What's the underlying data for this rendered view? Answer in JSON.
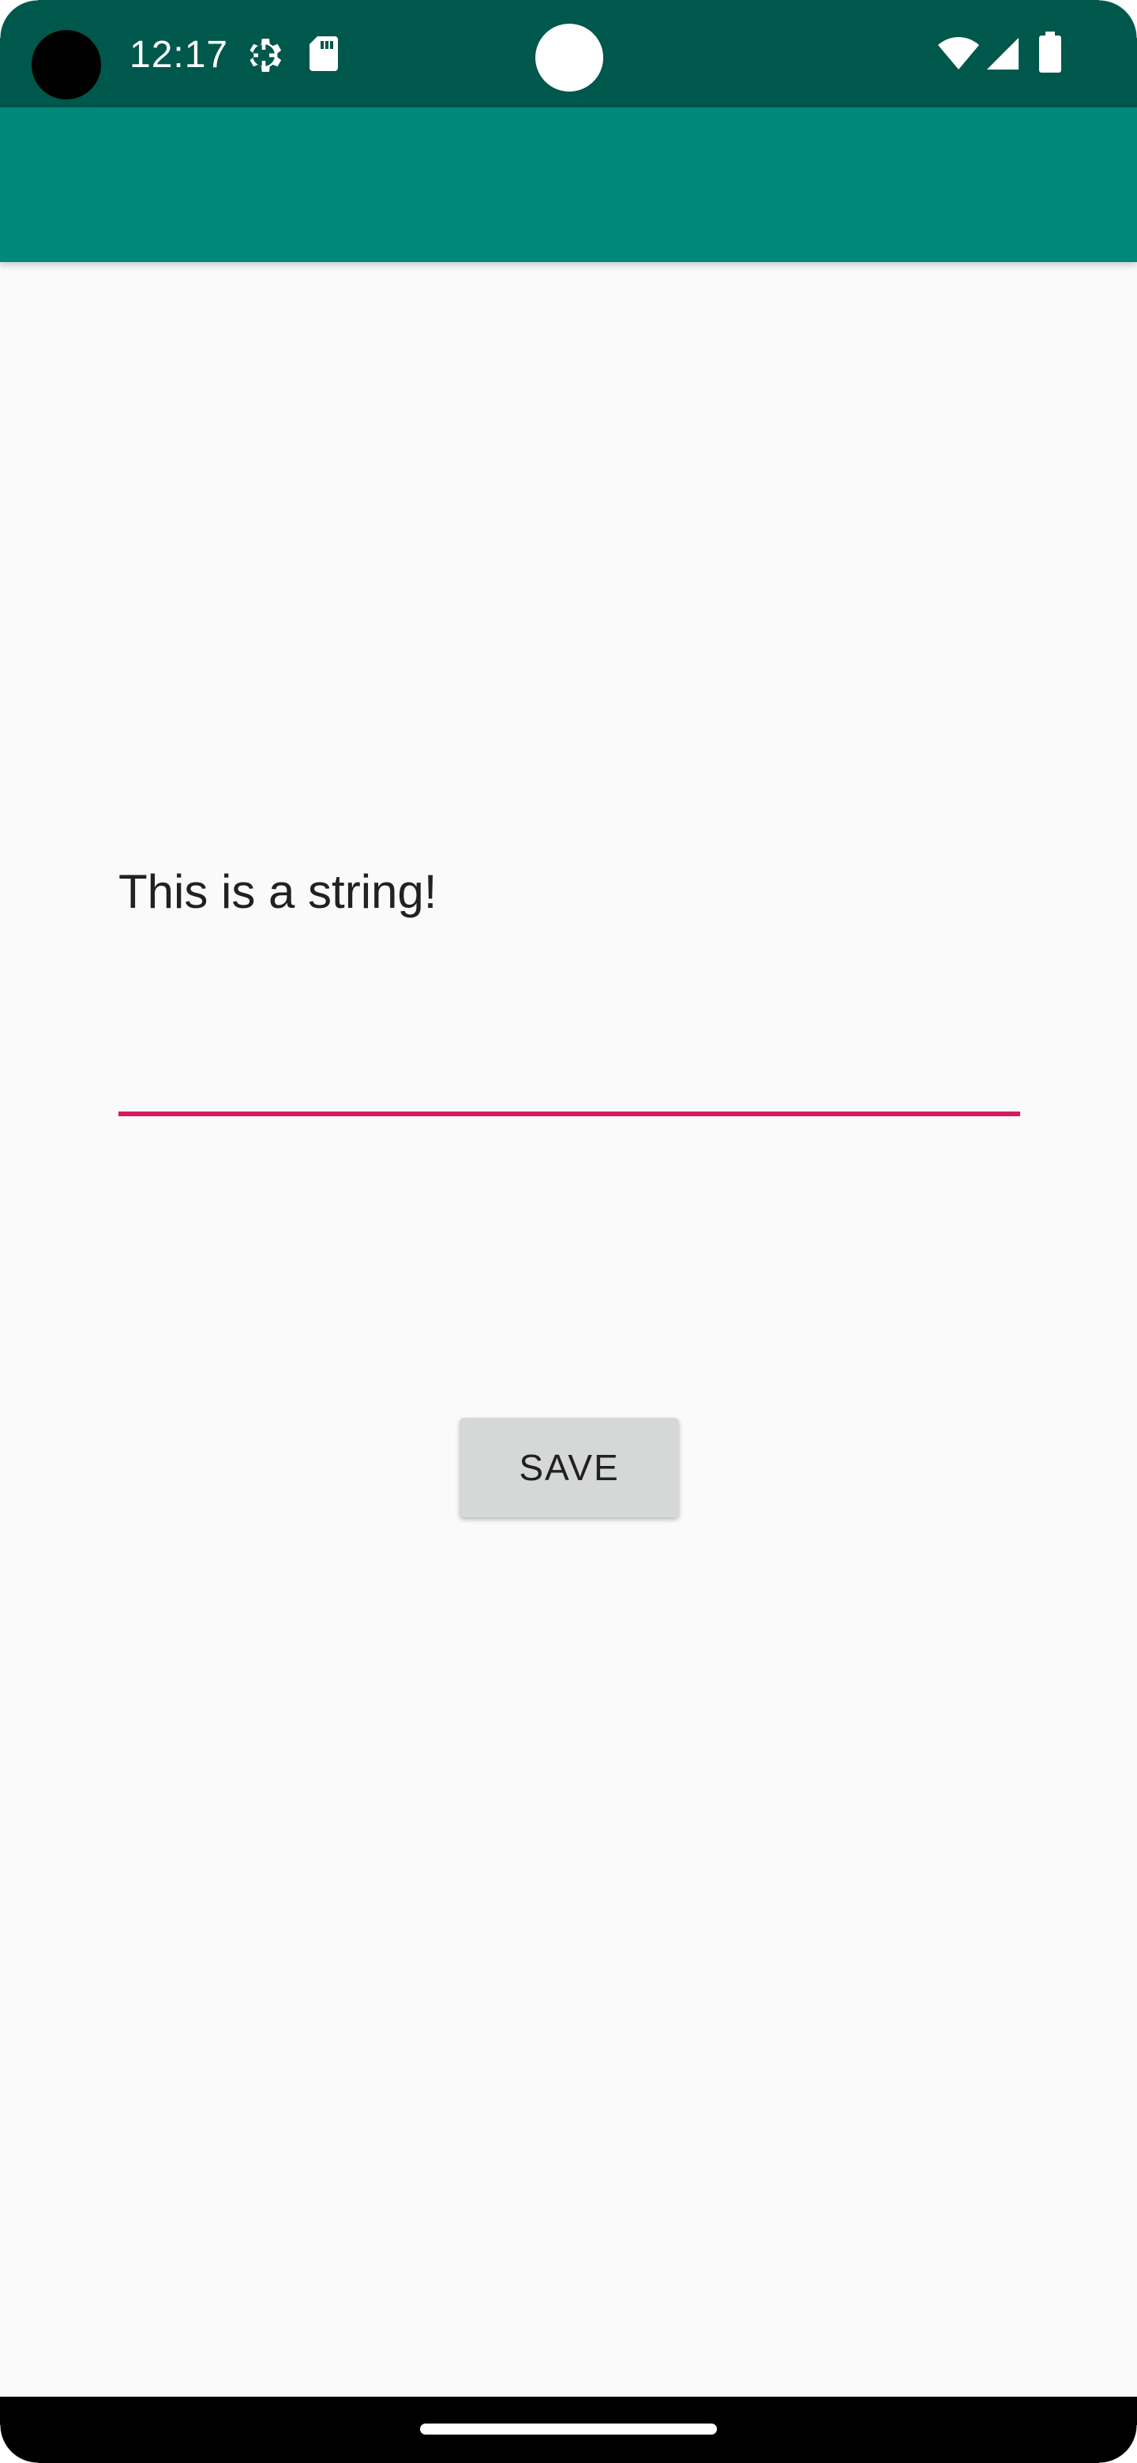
{
  "status_bar": {
    "time": "12:17",
    "icons": [
      "gear-icon",
      "sd-card-icon",
      "wifi-icon",
      "cell-signal-icon",
      "battery-icon"
    ],
    "background_color": "#00574b"
  },
  "app_bar": {
    "background_color": "#00897b"
  },
  "main": {
    "text_field": {
      "value": "This is a string!",
      "underline_color": "#d81b60"
    },
    "save_button": {
      "label": "SAVE"
    }
  },
  "nav_bar": {
    "handle": "home-gesture-handle"
  }
}
